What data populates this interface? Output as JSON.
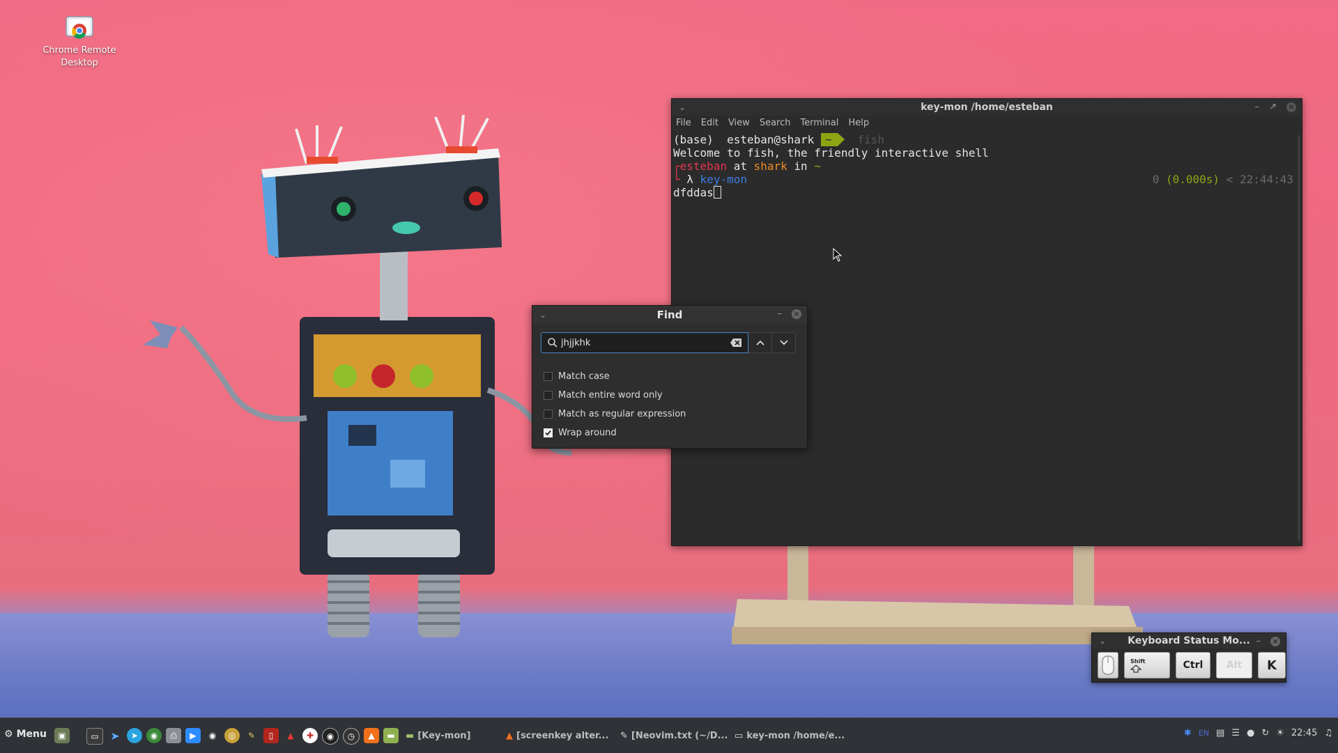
{
  "desktop": {
    "icons": [
      {
        "label": "Chrome Remote Desktop",
        "icon": "chrome-remote-desktop-icon"
      }
    ]
  },
  "terminal": {
    "title": "key-mon /home/esteban",
    "menu": [
      "File",
      "Edit",
      "View",
      "Search",
      "Terminal",
      "Help"
    ],
    "lines": {
      "prompt1_env": "(base)",
      "prompt1_user": " esteban@shark ",
      "prompt1_dir": "~",
      "prompt1_cmd": " fish",
      "welcome": "Welcome to fish, the friendly interactive shell",
      "p2_user": "esteban",
      "p2_at": " at ",
      "p2_host": "shark",
      "p2_in": " in ",
      "p2_dir": "~",
      "p3_lambda": " λ ",
      "p3_cmd": "key-mon",
      "p3_right_status": "0",
      "p3_right_duration": "(0.000s)",
      "p3_right_time": "< 22:44:43",
      "input": "dfddas"
    }
  },
  "find_dialog": {
    "title": "Find",
    "search_value": "jhjjkhk",
    "options": [
      {
        "label": "Match case",
        "checked": false
      },
      {
        "label": "Match entire word only",
        "checked": false
      },
      {
        "label": "Match as regular expression",
        "checked": false
      },
      {
        "label": "Wrap around",
        "checked": true
      }
    ]
  },
  "keyboard_status": {
    "title": "Keyboard Status Mo...",
    "keys": {
      "shift": "Shift",
      "ctrl": "Ctrl",
      "alt": "Alt",
      "k": "K"
    }
  },
  "taskbar": {
    "menu_label": "Menu",
    "tasks": [
      {
        "label": "[Key-mon]",
        "icon": "folder-icon"
      },
      {
        "label": "[screenkey alter...",
        "icon": "brave-icon"
      },
      {
        "label": "[Neovim.txt (~/D...",
        "icon": "text-editor-icon"
      },
      {
        "label": "key-mon /home/e...",
        "icon": "terminal-icon"
      }
    ],
    "clock": "22:45",
    "tray_lang": "EN"
  },
  "colors": {
    "prompt_green": "#8ea513",
    "prompt_red": "#e5364f",
    "prompt_orange": "#f08a24",
    "prompt_blue": "#3d7de0",
    "focus_blue": "#4b86c8"
  }
}
